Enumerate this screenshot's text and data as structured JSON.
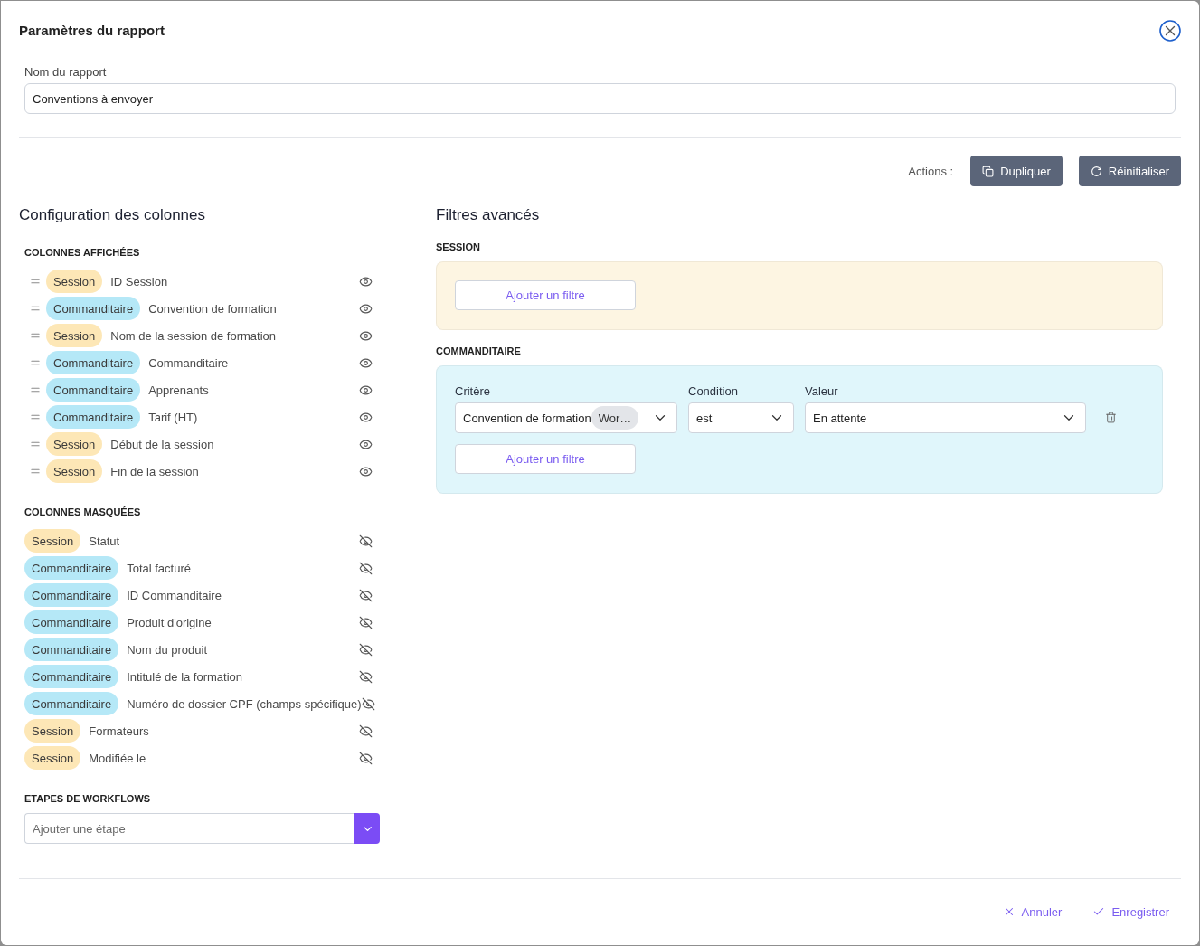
{
  "dialog": {
    "title": "Paramètres du rapport"
  },
  "report_name": {
    "label": "Nom du rapport",
    "value": "Conventions à envoyer"
  },
  "actions": {
    "label": "Actions :",
    "buttons": [
      {
        "kind": "duplicate",
        "label": "Dupliquer"
      },
      {
        "kind": "reset",
        "label": "Réinitialiser"
      }
    ]
  },
  "columns": {
    "title": "Configuration des colonnes",
    "sections": [
      {
        "heading": "COLONNES AFFICHÉES",
        "draggable": true,
        "items": [
          {
            "tag": "Session",
            "color": "#fde7b6",
            "label": "ID Session",
            "visible": true
          },
          {
            "tag": "Commanditaire",
            "color": "#b5e8f7",
            "label": "Convention de formation",
            "visible": true
          },
          {
            "tag": "Session",
            "color": "#fde7b6",
            "label": "Nom de la session de formation",
            "visible": true
          },
          {
            "tag": "Commanditaire",
            "color": "#b5e8f7",
            "label": "Commanditaire",
            "visible": true
          },
          {
            "tag": "Commanditaire",
            "color": "#b5e8f7",
            "label": "Apprenants",
            "visible": true
          },
          {
            "tag": "Commanditaire",
            "color": "#b5e8f7",
            "label": "Tarif (HT)",
            "visible": true
          },
          {
            "tag": "Session",
            "color": "#fde7b6",
            "label": "Début de la session",
            "visible": true
          },
          {
            "tag": "Session",
            "color": "#fde7b6",
            "label": "Fin de la session",
            "visible": true
          }
        ]
      },
      {
        "heading": "COLONNES MASQUÉES",
        "draggable": false,
        "items": [
          {
            "tag": "Session",
            "color": "#fde7b6",
            "label": "Statut",
            "visible": false
          },
          {
            "tag": "Commanditaire",
            "color": "#b5e8f7",
            "label": "Total facturé",
            "visible": false
          },
          {
            "tag": "Commanditaire",
            "color": "#b5e8f7",
            "label": "ID Commanditaire",
            "visible": false
          },
          {
            "tag": "Commanditaire",
            "color": "#b5e8f7",
            "label": "Produit d'origine",
            "visible": false
          },
          {
            "tag": "Commanditaire",
            "color": "#b5e8f7",
            "label": "Nom du produit",
            "visible": false
          },
          {
            "tag": "Commanditaire",
            "color": "#b5e8f7",
            "label": "Intitulé de la formation",
            "visible": false
          },
          {
            "tag": "Commanditaire",
            "color": "#b5e8f7",
            "label": "Numéro de dossier CPF (champs spécifique)",
            "visible": false
          },
          {
            "tag": "Session",
            "color": "#fde7b6",
            "label": "Formateurs",
            "visible": false
          },
          {
            "tag": "Session",
            "color": "#fde7b6",
            "label": "Modifiée le",
            "visible": false
          }
        ]
      }
    ],
    "workflow": {
      "heading": "ETAPES DE WORKFLOWS",
      "placeholder": "Ajouter une étape"
    }
  },
  "filters": {
    "title": "Filtres avancés",
    "groups": [
      {
        "heading": "SESSION",
        "color": "#fdf5e2",
        "add_button": "Ajouter un filtre"
      },
      {
        "heading": "COMMANDITAIRE",
        "color": "#e0f6fb",
        "rows": [
          {
            "fields": [
              {
                "label": "Critère",
                "value": "Convention de formation",
                "chip": "Wor…"
              },
              {
                "label": "Condition",
                "value": "est"
              },
              {
                "label": "Valeur",
                "value": "En attente"
              }
            ]
          }
        ],
        "add_button": "Ajouter un filtre"
      }
    ]
  },
  "footer": {
    "buttons": [
      {
        "kind": "cancel",
        "label": "Annuler"
      },
      {
        "kind": "save",
        "label": "Enregistrer"
      }
    ]
  }
}
